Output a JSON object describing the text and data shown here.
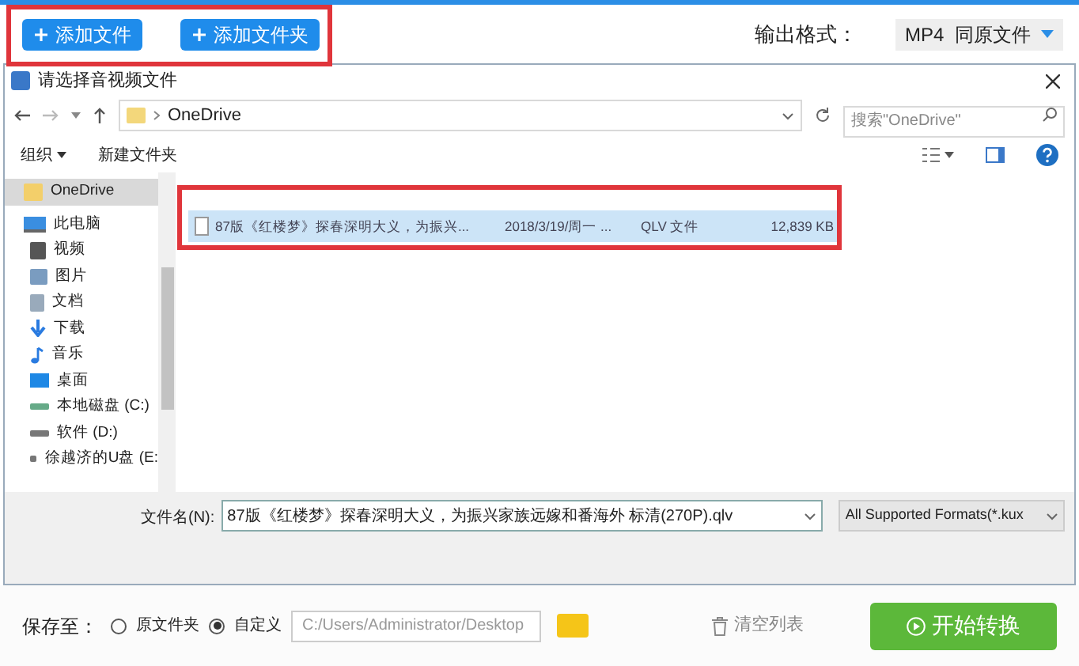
{
  "toolbar": {
    "buttons": [
      {
        "label": "添加文件"
      },
      {
        "label": "添加文件夹"
      }
    ],
    "output_format": {
      "label": "输出格式：",
      "value": "MP4  同原文件"
    }
  },
  "dialog": {
    "title": "请选择音视频文件",
    "path": "OneDrive",
    "search": {
      "placeholder": "搜索\"OneDrive\""
    },
    "commands": [
      {
        "label": "组织",
        "dropdown": true
      },
      {
        "label": "新建文件夹",
        "dropdown": false
      }
    ],
    "sidebar": {
      "items": [
        {
          "label": "OneDrive",
          "selected": true
        },
        {
          "label": "此电脑",
          "selected": false
        },
        {
          "label": "视频",
          "selected": false
        },
        {
          "label": "图片",
          "selected": false
        },
        {
          "label": "文档",
          "selected": false
        },
        {
          "label": "下载",
          "selected": false
        },
        {
          "label": "音乐",
          "selected": false
        },
        {
          "label": "桌面",
          "selected": false
        },
        {
          "label": "本地磁盘 (C:)",
          "selected": false
        },
        {
          "label": "软件 (D:)",
          "selected": false
        },
        {
          "label": "徐越济的U盘 (E:",
          "selected": false
        }
      ]
    },
    "table": {
      "rows": [
        {
          "name": "87版《红楼梦》探春深明大义，为振兴...",
          "date": "2018/3/19/周一 ...",
          "type": "QLV 文件",
          "size": "12,839 KB",
          "selected": true
        }
      ]
    },
    "filename": {
      "label": "文件名(N):",
      "value": "87版《红楼梦》探春深明大义，为振兴家族远嫁和番海外 标清(270P).qlv"
    },
    "filter": {
      "value": "All Supported Formats(*.kux"
    }
  },
  "save": {
    "label": "保存至：",
    "options": [
      {
        "label": "原文件夹",
        "selected": false
      },
      {
        "label": "自定义",
        "selected": true
      }
    ],
    "path": "C:/Users/Administrator/Desktop"
  },
  "clear_button": {
    "label": "清空列表"
  },
  "start_button": {
    "label": "开始转换"
  }
}
